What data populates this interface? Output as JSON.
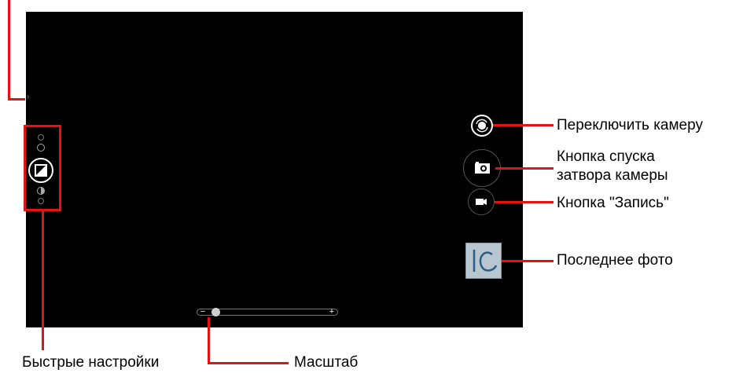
{
  "camera_app": {
    "edge_arrow": "›",
    "quick_settings": {
      "icons": [
        "info-icon",
        "scene-icon",
        "exposure-icon",
        "contrast-icon",
        "white-balance-icon"
      ]
    },
    "controls": {
      "switch_camera": {
        "icon": "switch-camera-icon"
      },
      "shutter": {
        "icon": "camera-icon"
      },
      "record": {
        "icon": "video-camera-icon"
      },
      "last_photo": {
        "thumbnail_text": "10"
      }
    },
    "zoom": {
      "minus_label": "−",
      "plus_label": "+",
      "level": 0.05
    }
  },
  "annotations": {
    "switch_camera": "Переключить камеру",
    "shutter_line1": "Кнопка спуска",
    "shutter_line2": "затвора камеры",
    "record": "Кнопка \"Запись\"",
    "last_photo": "Последнее фото",
    "quick_settings": "Быстрые настройки",
    "zoom": "Масштаб"
  },
  "colors": {
    "callout_red": "#e8110f",
    "screen_bg": "#000000"
  }
}
